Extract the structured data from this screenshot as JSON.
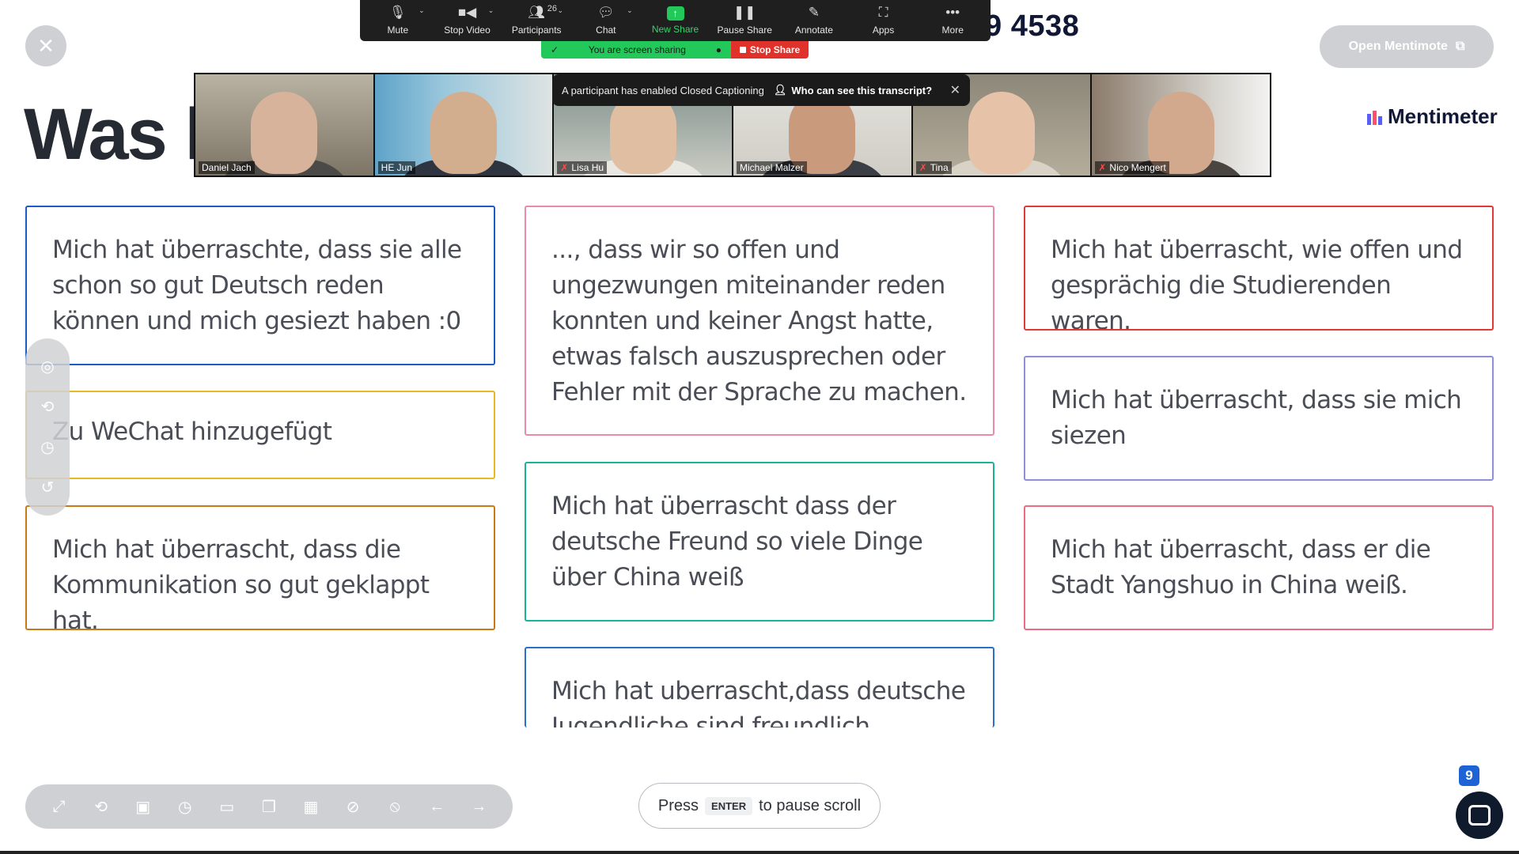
{
  "slide": {
    "title_visible": "Was h",
    "code_visible": "9 4538",
    "open_button_label": "Open Mentimote",
    "brand": "Mentimeter",
    "cards": [
      {
        "text": "Mich hat überraschte, dass sie alle schon so gut Deutsch reden können und mich gesiezt haben :0",
        "color": "#1f5bc4"
      },
      {
        "text": "Zu WeChat hinzugefügt",
        "color": "#e8b923"
      },
      {
        "text": "Mich hat überrascht, dass die Kommunikation so gut geklappt hat.",
        "color": "#c97a14"
      },
      {
        "text": "..., dass wir so offen und ungezwungen miteinander reden konnten und keiner Angst hatte, etwas falsch auszusprechen oder Fehler mit der Sprache zu machen.",
        "color": "#e98aa8"
      },
      {
        "text": "Mich hat überrascht dass der deutsche Freund so viele Dinge über China weiß",
        "color": "#19b39a"
      },
      {
        "text": "Mich hat uberrascht,dass deutsche Jugendliche sind freundlich",
        "color": "#2b6fc9"
      },
      {
        "text": "Mich hat überrascht, wie offen und gesprächig die Studierenden waren.",
        "color": "#e0393a"
      },
      {
        "text": "Mich hat überrascht, dass sie mich siezen",
        "color": "#8e8fd6"
      },
      {
        "text": "Mich hat überrascht, dass er die Stadt Yangshuo in China weiß.",
        "color": "#ea6b82"
      }
    ],
    "scroll_hint": {
      "press": "Press",
      "key": "ENTER",
      "rest": "to pause scroll"
    },
    "chat_badge": "9"
  },
  "zoom": {
    "toolbar": [
      {
        "label": "Mute",
        "icon": "microphone-icon"
      },
      {
        "label": "Stop Video",
        "icon": "video-camera-icon"
      },
      {
        "label": "Participants",
        "icon": "participants-icon",
        "count": "26"
      },
      {
        "label": "Chat",
        "icon": "chat-icon"
      },
      {
        "label": "New Share",
        "icon": "share-screen-icon"
      },
      {
        "label": "Pause Share",
        "icon": "pause-icon"
      },
      {
        "label": "Annotate",
        "icon": "pencil-icon"
      },
      {
        "label": "Apps",
        "icon": "apps-icon"
      },
      {
        "label": "More",
        "icon": "more-icon"
      }
    ],
    "sharing_banner": "You are screen sharing",
    "stop_share": "Stop Share",
    "cc_notice": "A participant has enabled Closed Captioning",
    "cc_question": "Who can see this transcript?",
    "participants": [
      {
        "name": "Daniel Jach",
        "muted": false
      },
      {
        "name": "HE Jun",
        "muted": false
      },
      {
        "name": "Lisa Hu",
        "muted": true
      },
      {
        "name": "Michael Malzer",
        "muted": false
      },
      {
        "name": "Tina",
        "muted": true
      },
      {
        "name": "Nico Mengert",
        "muted": true
      }
    ]
  }
}
